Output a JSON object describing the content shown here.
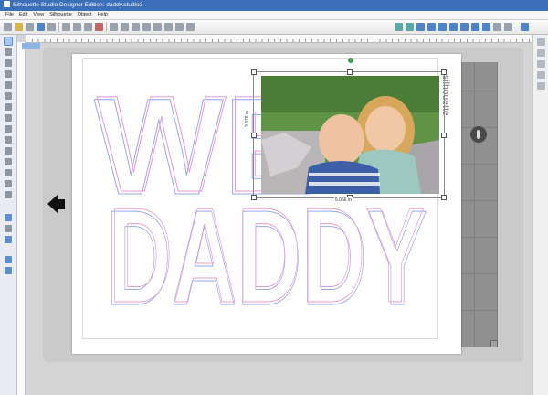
{
  "window": {
    "title": "Silhouette Studio Designer Edition: daddy.studio3"
  },
  "menu": [
    "File",
    "Edit",
    "View",
    "Silhouette",
    "Object",
    "Help"
  ],
  "ruler_tag": "",
  "design_text": {
    "line1": "WE",
    "line2": "DADDY"
  },
  "mat": {
    "brand": "silhouette"
  },
  "selection": {
    "width_label": "5.066 in",
    "height_label": "3.376 in"
  },
  "colors": {
    "titlebar": "#3c6fb8",
    "cut_line_pink": "#e79ad2",
    "cut_line_blue": "#9aa6ee",
    "selection_handle": "#3aa34a"
  },
  "icons": [
    "new-icon",
    "open-icon",
    "save-icon",
    "print-icon",
    "cut-icon",
    "copy-icon",
    "paste-icon",
    "undo-icon",
    "redo-icon",
    "pan-icon",
    "zoom-in-icon",
    "zoom-out-icon",
    "zoom-fit-icon",
    "grid-icon",
    "page-settings-icon",
    "cut-settings-icon",
    "send-to-silhouette-icon"
  ]
}
